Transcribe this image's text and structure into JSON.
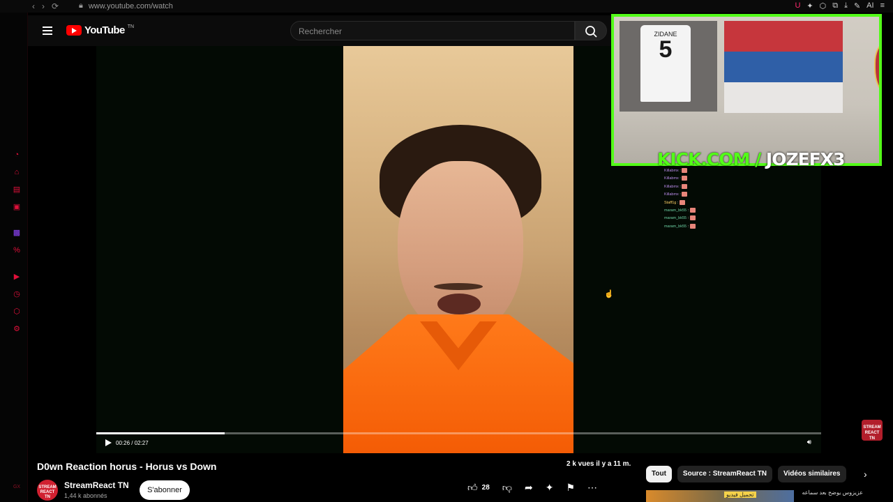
{
  "browser": {
    "url": "www.youtube.com/watch",
    "nav": [
      "‹",
      "›",
      "⟳"
    ],
    "extensions": [
      "U",
      "✦",
      "⬡",
      "⧉",
      "⤓",
      "✎",
      "AI",
      "≡"
    ]
  },
  "gx_rail": {
    "icons": [
      "speed-icon",
      "store-icon",
      "wallet-icon",
      "messenger-icon",
      "twitch-icon",
      "percent-icon",
      "player-icon",
      "history-icon",
      "extensions-icon",
      "settings-icon",
      "gx-logo-icon"
    ],
    "logo_text": "GX"
  },
  "header": {
    "logo_text": "YouTube",
    "country_code": "TN",
    "search_placeholder": "Rechercher"
  },
  "player": {
    "current_time": "00:26",
    "duration": "02:27",
    "time_display": "00:26 / 02:27",
    "progress_fraction": 0.177
  },
  "overlay": {
    "kick_brand": "KICK.COM /",
    "kick_user": "JOZEFX3",
    "jersey_name": "ZIDANE",
    "jersey_number": "5",
    "chat": [
      {
        "user": "Killabmx",
        "msg": ":"
      },
      {
        "user": "Killabmx",
        "msg": ":"
      },
      {
        "user": "Killabmx",
        "msg": ":"
      },
      {
        "user": "Killabmx",
        "msg": ":"
      },
      {
        "user": "Staff1g",
        "msg": ":"
      },
      {
        "user": "maram_bk55",
        "msg": ":"
      },
      {
        "user": "maram_bk55",
        "msg": ":"
      },
      {
        "user": "maram_bk55",
        "msg": ":"
      }
    ],
    "badge_text": "STREAM REACT TN"
  },
  "video": {
    "title": "D0wn Reaction horus - Horus vs Down",
    "views": "2 k vues",
    "age": "il y a 11 m.",
    "meta_line": "2 k vues  il y a 11 m.",
    "likes": "28",
    "channel": {
      "name": "StreamReact TN",
      "subscribers": "1,44 k abonnés",
      "avatar_text": "STREAM REACT TN",
      "subscribe_label": "S'abonner"
    }
  },
  "related": {
    "chips": [
      "Tout",
      "Source : StreamReact TN",
      "Vidéos similaires"
    ],
    "suggestion_thumb_text": "تحميل فيديو",
    "suggestion_title": "عزيزوس يوضح بعد سماعه"
  },
  "colors": {
    "kick_green": "#53fc18",
    "yt_red": "#ff0000",
    "gx_red": "#e0103a",
    "shirt_orange": "#f45c05"
  }
}
